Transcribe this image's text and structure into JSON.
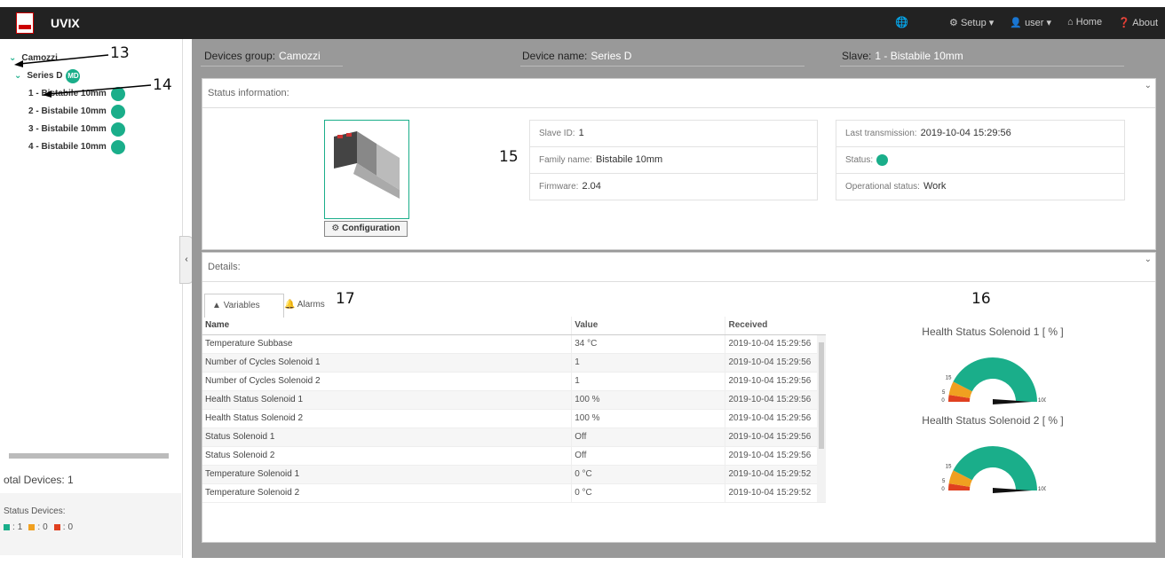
{
  "app": {
    "title": "UVIX"
  },
  "nav": {
    "setup": "Setup ▾",
    "user": "user ▾",
    "home": "Home",
    "about": "About"
  },
  "sidebar": {
    "tree": {
      "group": "Camozzi",
      "device": "Series D",
      "device_badge": "MD",
      "slaves": [
        "1 - Bistabile 10mm",
        "2 - Bistabile 10mm",
        "3 - Bistabile 10mm",
        "4 - Bistabile 10mm"
      ]
    },
    "total_devices": "otal Devices: 1",
    "status_devices_label": "Status Devices:",
    "status_counts": {
      "ok": "1",
      "warn": "0",
      "err": "0"
    }
  },
  "header": {
    "group_label": "Devices group:",
    "group_value": "Camozzi",
    "device_label": "Device name:",
    "device_value": "Series D",
    "slave_label": "Slave:",
    "slave_value": "1 - Bistabile 10mm"
  },
  "status_panel": {
    "title": "Status information:",
    "config_button": "Configuration",
    "slave_id_label": "Slave ID:",
    "slave_id": "1",
    "family_label": "Family name:",
    "family": "Bistabile 10mm",
    "firmware_label": "Firmware:",
    "firmware": "2.04",
    "last_tx_label": "Last transmission:",
    "last_tx": "2019-10-04 15:29:56",
    "status_label": "Status:",
    "op_status_label": "Operational status:",
    "op_status": "Work"
  },
  "details_panel": {
    "title": "Details:",
    "tabs": {
      "variables": "Variables",
      "alarms": "Alarms"
    },
    "columns": [
      "Name",
      "Value",
      "Received"
    ],
    "rows": [
      [
        "Temperature Subbase",
        "34 °C",
        "2019-10-04 15:29:56"
      ],
      [
        "Number of Cycles Solenoid 1",
        "1",
        "2019-10-04 15:29:56"
      ],
      [
        "Number of Cycles Solenoid 2",
        "1",
        "2019-10-04 15:29:56"
      ],
      [
        "Health Status Solenoid 1",
        "100 %",
        "2019-10-04 15:29:56"
      ],
      [
        "Health Status Solenoid 2",
        "100 %",
        "2019-10-04 15:29:56"
      ],
      [
        "Status Solenoid 1",
        "Off",
        "2019-10-04 15:29:56"
      ],
      [
        "Status Solenoid 2",
        "Off",
        "2019-10-04 15:29:56"
      ],
      [
        "Temperature Solenoid 1",
        "0 °C",
        "2019-10-04 15:29:52"
      ],
      [
        "Temperature Solenoid 2",
        "0 °C",
        "2019-10-04 15:29:52"
      ]
    ],
    "gauges": [
      {
        "title": "Health Status Solenoid 1 [ % ]",
        "value": 100,
        "ticks": [
          "0",
          "5",
          "15",
          "100"
        ]
      },
      {
        "title": "Health Status Solenoid 2 [ % ]",
        "value": 100,
        "ticks": [
          "0",
          "5",
          "15",
          "100"
        ]
      }
    ]
  },
  "annotations": {
    "a13": "13",
    "a14": "14",
    "a15": "15",
    "a16": "16",
    "a17": "17"
  },
  "colors": {
    "accent": "#1aae8a",
    "warn": "#f0a020",
    "error": "#e04020"
  }
}
